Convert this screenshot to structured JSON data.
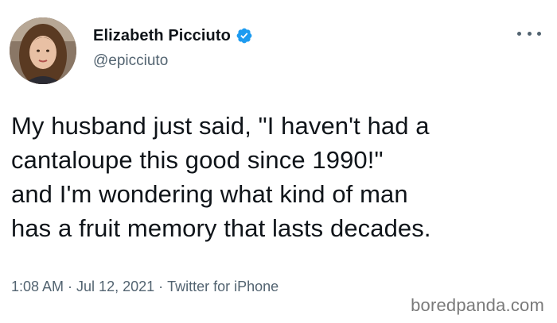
{
  "author": {
    "display_name": "Elizabeth Picciuto",
    "handle": "@epicciuto",
    "verified": true
  },
  "icons": {
    "verified": "verified-badge-icon",
    "more": "more-options-icon"
  },
  "tweet": {
    "text": "My husband just said, \"I haven't had a\ncantaloupe this good since 1990!\"\nand I'm wondering what kind of man\nhas a fruit memory that lasts decades."
  },
  "meta": {
    "time": "1:08 AM",
    "separator": "·",
    "date": "Jul 12, 2021",
    "source": "Twitter for iPhone"
  },
  "watermark": "boredpanda.com",
  "colors": {
    "text_primary": "#0f1419",
    "text_secondary": "#536471",
    "verified_blue": "#1d9bf0",
    "background": "#ffffff"
  }
}
